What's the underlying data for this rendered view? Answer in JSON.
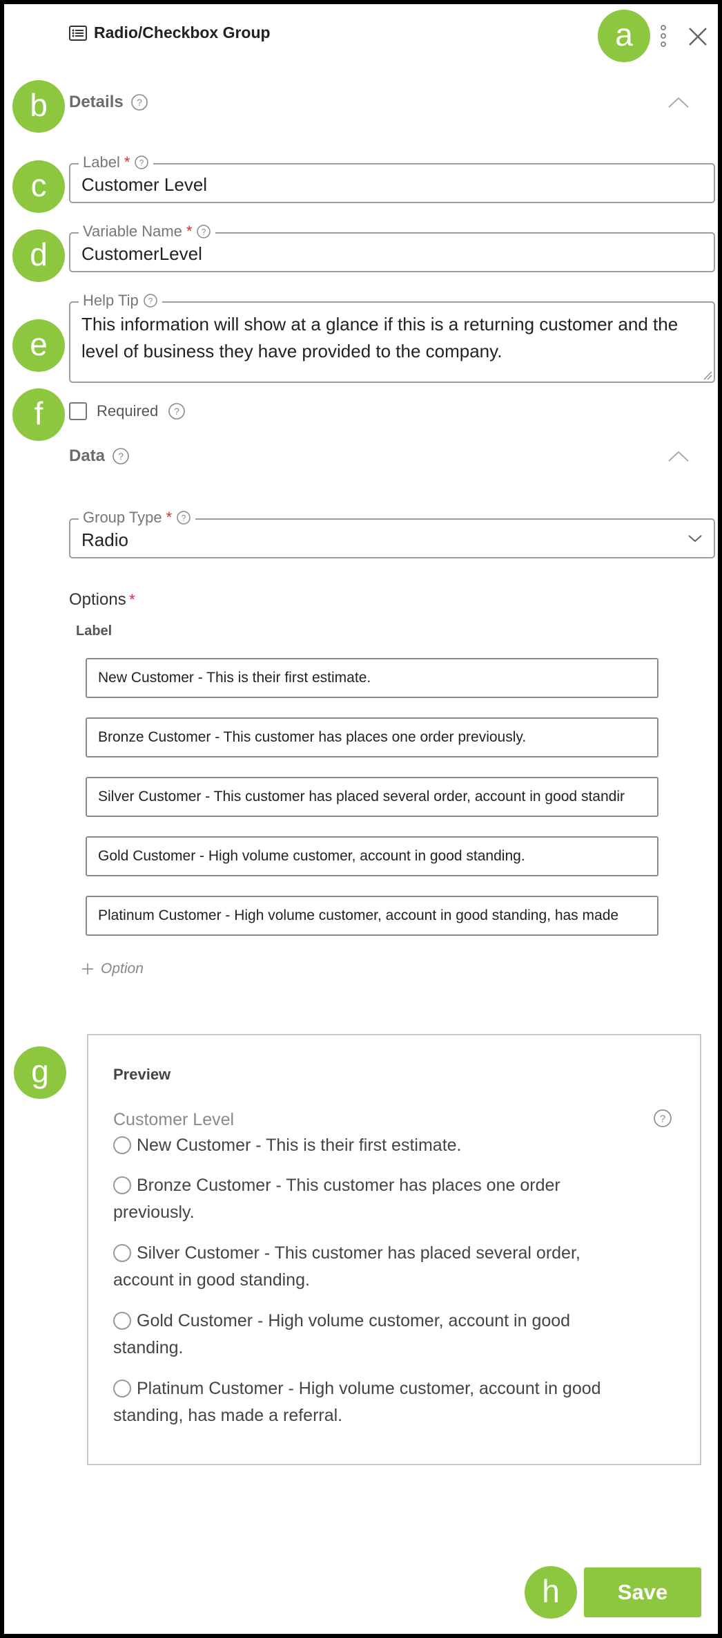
{
  "header": {
    "icon": "list-icon",
    "title": "Radio/Checkbox Group",
    "menu_icon": "more-vertical-icon",
    "close_icon": "close-icon"
  },
  "badges": {
    "a": "a",
    "b": "b",
    "c": "c",
    "d": "d",
    "e": "e",
    "f": "f",
    "g": "g",
    "h": "h"
  },
  "details": {
    "title": "Details",
    "label_field": {
      "label": "Label",
      "required_mark": "*",
      "value": "Customer Level"
    },
    "variable_field": {
      "label": "Variable Name",
      "required_mark": "*",
      "value": "CustomerLevel"
    },
    "help_tip_field": {
      "label": "Help Tip",
      "value": "This information will show at a glance if this is a returning customer and the level of business they have provided to the company."
    },
    "required_checkbox": {
      "label": "Required",
      "checked": false
    }
  },
  "data_section": {
    "title": "Data",
    "group_type": {
      "label": "Group Type",
      "required_mark": "*",
      "value": "Radio"
    },
    "options_label": "Options",
    "options_required_mark": "*",
    "column_label": "Label",
    "options": [
      "New Customer - This is their first estimate.",
      "Bronze Customer - This customer has places one order previously.",
      "Silver Customer - This customer has placed several order, account in good standir",
      "Gold Customer - High volume customer, account in good standing.",
      "Platinum Customer - High volume customer, account in good standing, has made"
    ],
    "add_option_label": "Option"
  },
  "preview": {
    "title": "Preview",
    "field_label": "Customer Level",
    "items": [
      "New Customer - This is their first estimate.",
      "Bronze Customer - This customer has places one order previously.",
      "Silver Customer - This customer has placed several order, account in good standing.",
      "Gold Customer - High volume customer, account in good standing.",
      "Platinum Customer - High volume customer, account in good standing, has made a referral."
    ]
  },
  "footer": {
    "save_label": "Save"
  },
  "colors": {
    "accent": "#8dc63f",
    "required": "#d32f2f"
  }
}
